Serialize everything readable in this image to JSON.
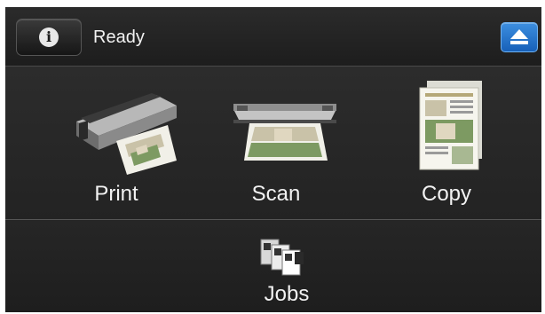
{
  "status_bar": {
    "info_icon": "info-icon",
    "info_glyph": "i",
    "status": "Ready",
    "eject_icon": "eject-icon"
  },
  "functions": [
    {
      "label": "Print",
      "icon": "printer-icon"
    },
    {
      "label": "Scan",
      "icon": "scanner-icon"
    },
    {
      "label": "Copy",
      "icon": "copy-icon"
    }
  ],
  "jobs": {
    "label": "Jobs",
    "icon": "jobs-queue-icon"
  },
  "colors": {
    "background": "#1f1f1f",
    "accent_blue": "#1e6fc8",
    "text": "#f2f2f2"
  }
}
